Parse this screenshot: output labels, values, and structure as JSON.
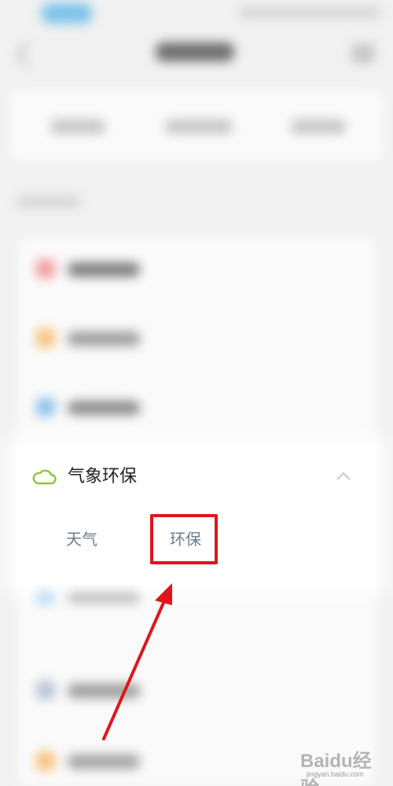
{
  "focused_card": {
    "title": "气象环保",
    "items": [
      {
        "label": "天气"
      },
      {
        "label": "环保"
      }
    ],
    "highlighted_item": "环保"
  },
  "colors": {
    "highlight": "#e1141c",
    "cloud_icon": "#8dc63f",
    "sub_item_text": "#6a7d8a"
  },
  "icons": {
    "card_icon": "cloud-icon",
    "collapse": "chevron-up-icon"
  },
  "watermark": {
    "brand": "Baidu经验",
    "url": "jingyan.baidu.com"
  }
}
